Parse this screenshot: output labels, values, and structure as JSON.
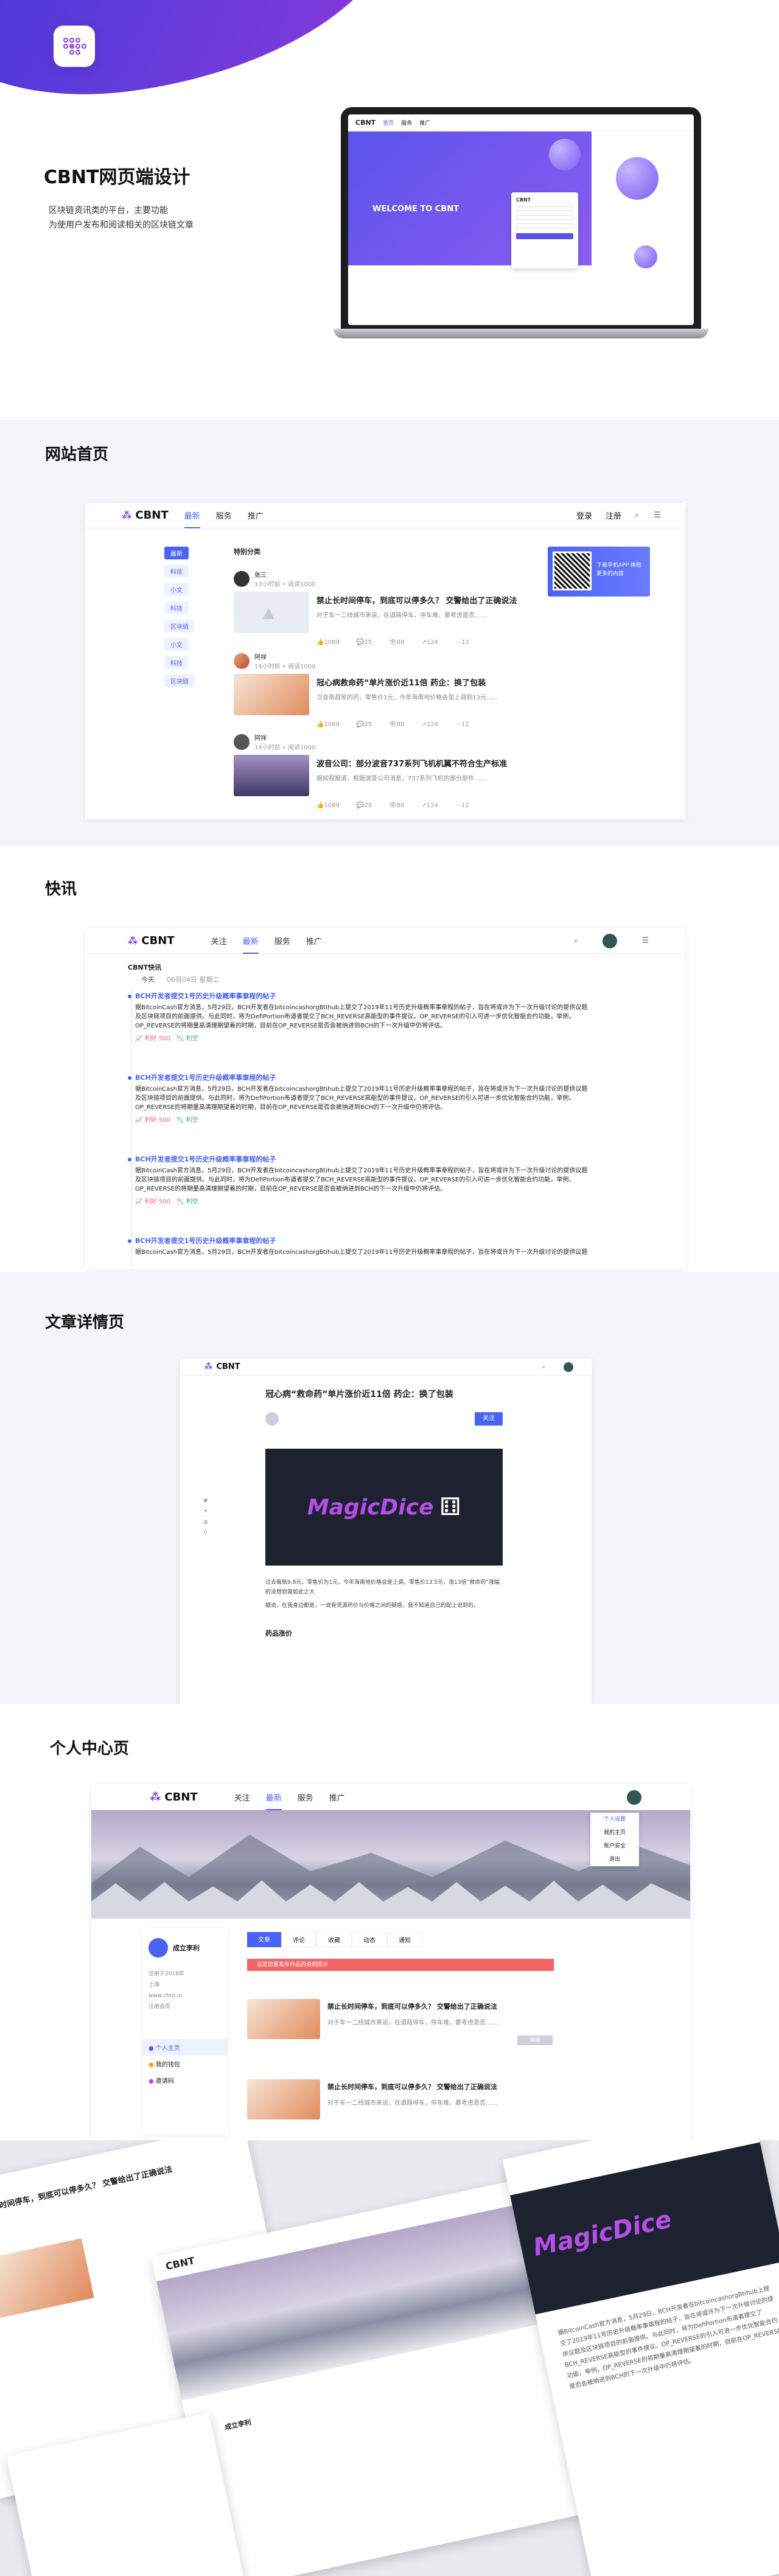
{
  "hero": {
    "title": "CBNT网页端设计",
    "desc_line1": "区块链资讯类的平台，主要功能",
    "desc_line2": "为使用户发布和阅读相关的区块链文章",
    "laptop": {
      "brand": "CBNT",
      "nav": [
        "首页",
        "服务",
        "推广"
      ],
      "welcome": "WELCOME TO CBNT"
    }
  },
  "sections": {
    "home": "网站首页",
    "news": "快讯",
    "detail": "文章详情页",
    "profile": "个人中心页"
  },
  "brand": "CBNT",
  "home": {
    "nav": [
      "最新",
      "服务",
      "推广"
    ],
    "login": "登录",
    "register": "注册",
    "tag_title": "特别分类",
    "tags": [
      "最新",
      "科技",
      "小文",
      "科技",
      "区块链",
      "小文",
      "科技",
      "区块链"
    ],
    "qr_text": "下载手机APP 体验更多的内容",
    "articles": [
      {
        "author": "张三",
        "time": "13小时前 • 阅读1000",
        "title": "禁止长时间停车，到底可以停多久？ 交警给出了正确说法",
        "desc": "对于车一二线城市来说，在道路停车，停车难，要考虑是否……",
        "likes": "1089",
        "comments": "25",
        "views": "88",
        "shares": "124",
        "more": "12"
      },
      {
        "author": "阿祥",
        "time": "14小时前 • 阅读1000",
        "title": "冠心病救命药“单片涨价近11倍 药企：换了包装",
        "desc": "汉会南昌家的药，零售价1元，今年海南地价格会是上调到13元……",
        "likes": "1089",
        "comments": "25",
        "views": "88",
        "shares": "124",
        "more": "12"
      },
      {
        "author": "阿祥",
        "time": "14小时前 • 阅读1000",
        "title": "波音公司：部分波音737系列飞机机翼不符合生产标准",
        "desc": "据前程报道，根据波音公司消息，737系列飞机的部分部件……",
        "likes": "1089",
        "comments": "25",
        "views": "88",
        "shares": "124",
        "more": "12"
      }
    ]
  },
  "news": {
    "nav": [
      "关注",
      "最新",
      "服务",
      "推广"
    ],
    "label": "CBNT快讯",
    "today": "今天",
    "date": "06月04日 星期二",
    "item_title": "BCH开发者提交1号历史升级概率事章程的帖子",
    "item_body": "据BitcoinCash官方消息，5月29日，BCH开发者在bitcoincashorgBtihub上提交了2019年11号历史升级概率事章程的帖子，旨在将或许为下一次升级讨论的提供议题及区块链项目的前面提供。与此同时，将为DefiPortion布道者提交了BCH_REVERSE高能型的事件提议，OP_REVERSE的引入可进一步优化智能合约功能，举例，OP_REVERSE的将期量高清理期望着的时期，目前在OP_REVERSE是否会被纳进到BCH的下一次升级中仍将评估。",
    "likes": "500",
    "actions": [
      "利好",
      "利空"
    ]
  },
  "detail": {
    "title": "冠心病“救命药”单片涨价近11倍 药企：换了包装",
    "follow": "关注",
    "banner": "MagicDice",
    "para1": "过去每瓶9.8元，零售价为1元，今年海南地价格会是上调，零售价13.5元，涨13倍“救命药”涨幅的没想到竟如此之大",
    "para2": "据说，在我身边都是，一说有资源药价与价格之间的疑惑，我不知道自己的配上说到的。",
    "para3": "药品信息",
    "more_title": "药品涨价"
  },
  "profile": {
    "nav": [
      "关注",
      "最新",
      "服务",
      "推广"
    ],
    "username": "成立李利",
    "menu_items": [
      "个人主页",
      "我的钱包",
      "邀请码"
    ],
    "dropdown": [
      "个人设置",
      "我的主页",
      "账户安全",
      "退出"
    ],
    "tabs": [
      "文章",
      "评论",
      "收藏",
      "动态",
      "通知"
    ],
    "alert": "这是您要发布作品的说明提示",
    "info": [
      "注册于2018年",
      "上海",
      "www.cbnt.io",
      "注册会员"
    ],
    "btn": "编辑"
  },
  "colors": {
    "accent": "#4a63f2",
    "brand_purple": "#7b3fe4",
    "alert_red": "#f36464"
  }
}
